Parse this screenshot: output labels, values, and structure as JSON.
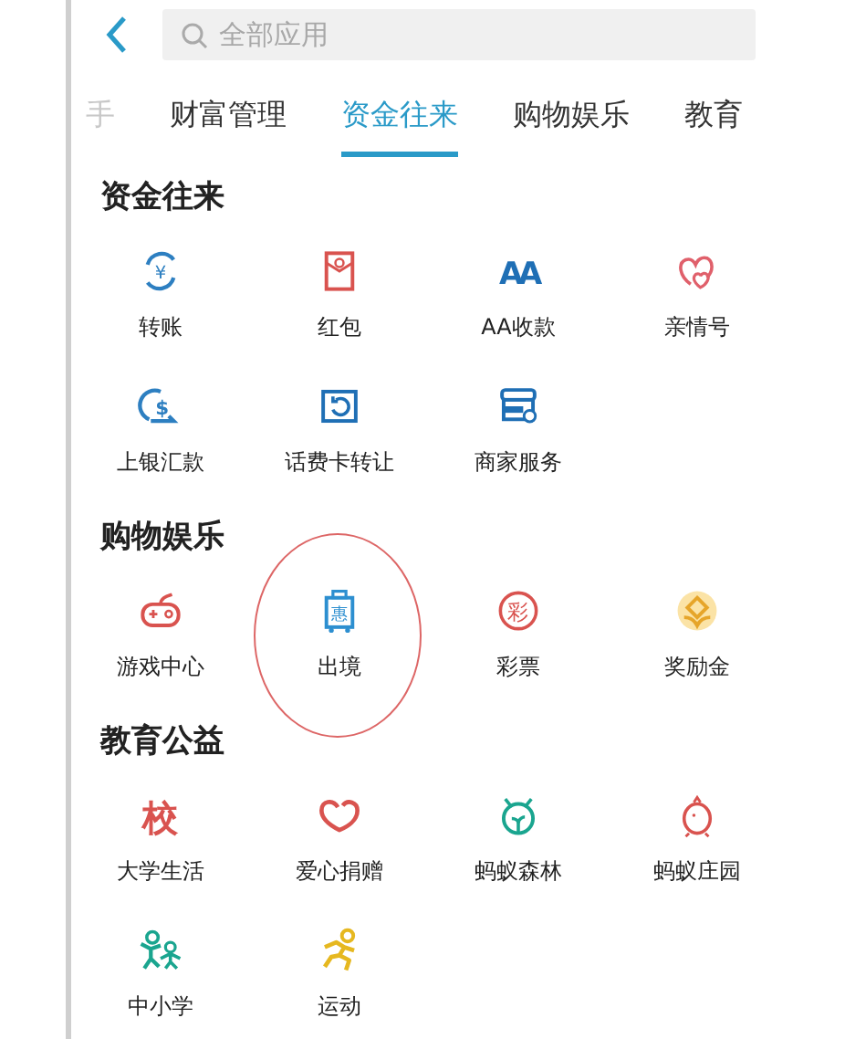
{
  "header": {
    "search": {
      "placeholder": "全部应用"
    }
  },
  "tabs": [
    {
      "label": "手",
      "selected": false
    },
    {
      "label": "财富管理",
      "selected": false
    },
    {
      "label": "资金往来",
      "selected": true
    },
    {
      "label": "购物娱乐",
      "selected": false
    },
    {
      "label": "教育",
      "selected": false
    }
  ],
  "sections": [
    {
      "title": "资金往来",
      "items": [
        {
          "label": "转账",
          "kind": "transfer",
          "glyph": "¥",
          "color": "#2d7fc1",
          "circled": false
        },
        {
          "label": "红包",
          "kind": "redpacket",
          "color": "#d9534f",
          "circled": false
        },
        {
          "label": "AA收款",
          "kind": "aa",
          "glyph": "AA",
          "color": "#1f6fb5",
          "circled": false
        },
        {
          "label": "亲情号",
          "kind": "hearts",
          "color": "#e0606b",
          "circled": false
        },
        {
          "label": "上银汇款",
          "kind": "remit",
          "glyph": "$",
          "color": "#2d7fc1",
          "circled": false
        },
        {
          "label": "话费卡转让",
          "kind": "card",
          "color": "#1f6fb5",
          "circled": false
        },
        {
          "label": "商家服务",
          "kind": "shop",
          "color": "#1f6fb5",
          "circled": false
        }
      ]
    },
    {
      "title": "购物娱乐",
      "items": [
        {
          "label": "游戏中心",
          "kind": "gamepad",
          "color": "#d9534f",
          "circled": false
        },
        {
          "label": "出境",
          "kind": "suitcase",
          "glyph": "惠",
          "color": "#2d8fd0",
          "circled": true
        },
        {
          "label": "彩票",
          "kind": "lottery",
          "glyph": "彩",
          "color": "#d9534f",
          "circled": false
        },
        {
          "label": "奖励金",
          "kind": "reward",
          "color": "#e6a52a",
          "circled": false
        }
      ]
    },
    {
      "title": "教育公益",
      "items": [
        {
          "label": "大学生活",
          "kind": "school",
          "glyph": "校",
          "color": "#d9534f",
          "circled": false
        },
        {
          "label": "爱心捐赠",
          "kind": "heart",
          "color": "#d9534f",
          "circled": false
        },
        {
          "label": "蚂蚁森林",
          "kind": "forest",
          "color": "#1aa58f",
          "circled": false
        },
        {
          "label": "蚂蚁庄园",
          "kind": "chick",
          "color": "#d9534f",
          "circled": false
        },
        {
          "label": "中小学",
          "kind": "kids",
          "color": "#1aa58f",
          "circled": false
        },
        {
          "label": "运动",
          "kind": "run",
          "color": "#e6b820",
          "circled": false
        }
      ]
    }
  ]
}
